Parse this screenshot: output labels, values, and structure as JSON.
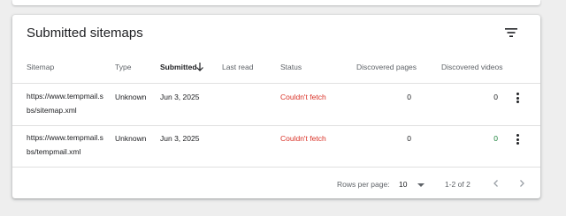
{
  "card": {
    "title": "Submitted sitemaps"
  },
  "columns": {
    "sitemap": "Sitemap",
    "type": "Type",
    "submitted": "Submitted",
    "last_read": "Last read",
    "status": "Status",
    "discovered_pages": "Discovered pages",
    "discovered_videos": "Discovered videos"
  },
  "rows": [
    {
      "sitemap": "https://www.tempmail.sbs/sitemap.xml",
      "type": "Unknown",
      "submitted": "Jun 3, 2025",
      "last_read": "",
      "status": "Couldn't fetch",
      "discovered_pages": "0",
      "discovered_videos": "0"
    },
    {
      "sitemap": "https://www.tempmail.sbs/tempmail.xml",
      "type": "Unknown",
      "submitted": "Jun 3, 2025",
      "last_read": "",
      "status": "Couldn't fetch",
      "discovered_pages": "0",
      "discovered_videos": "0"
    }
  ],
  "footer": {
    "rows_per_page_label": "Rows per page:",
    "rows_per_page_value": "10",
    "range": "1-2 of 2"
  },
  "icons": {
    "filter": "filter-icon",
    "sort": "arrow-down-icon",
    "more": "more-vert-icon",
    "prev": "chevron-left-icon",
    "next": "chevron-right-icon"
  },
  "colors": {
    "status_error": "#d93025",
    "videos_count": "#188038"
  }
}
